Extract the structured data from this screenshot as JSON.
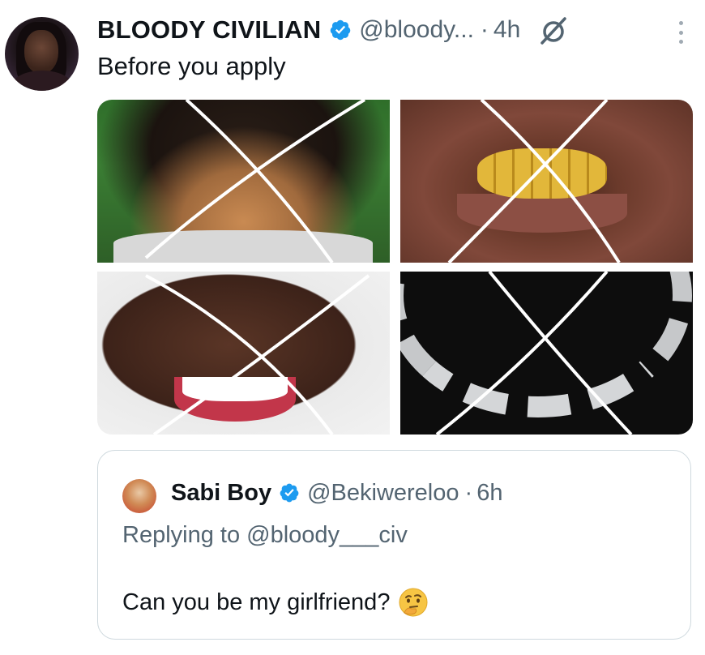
{
  "tweet": {
    "display_name": "BLOODY CIVILIAN",
    "handle": "@bloody...",
    "separator": "·",
    "time": "4h",
    "text": "Before you apply",
    "media": [
      {
        "icon": "braided-hair-photo"
      },
      {
        "icon": "gold-grillz-photo"
      },
      {
        "icon": "white-veneers-smile-photo"
      },
      {
        "icon": "iced-cuban-chain-photo"
      }
    ]
  },
  "quoted_tweet": {
    "display_name": "Sabi Boy",
    "handle": "@Bekiwereloo",
    "separator": "·",
    "time": "6h",
    "replying_prefix": "Replying to",
    "replying_handle": "@bloody___civ",
    "text": "Can you be my girlfriend?",
    "emoji": "thinking-face"
  },
  "colors": {
    "verified_blue": "#1d9bf0",
    "secondary_text": "#536471",
    "primary_text": "#0f1419",
    "cross_lines": "#ffffff"
  }
}
